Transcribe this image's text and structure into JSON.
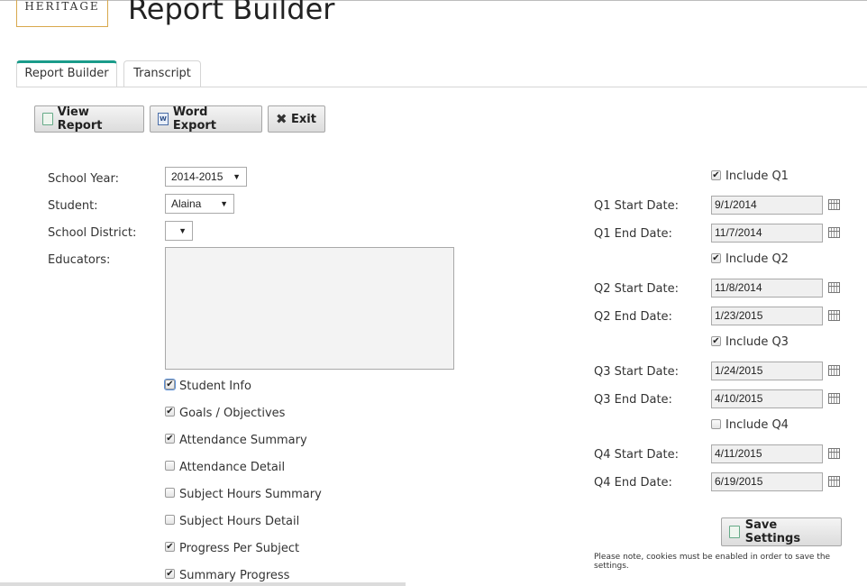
{
  "header": {
    "logo_text": "HERITAGE",
    "title": "Report Builder"
  },
  "tabs": [
    {
      "label": "Report Builder"
    },
    {
      "label": "Transcript"
    }
  ],
  "toolbar": {
    "view_report": "View Report",
    "word_export": "Word Export",
    "exit": "Exit"
  },
  "form": {
    "school_year_label": "School Year:",
    "school_year_value": "2014-2015",
    "student_label": "Student:",
    "student_value": "Alaina",
    "district_label": "School District:",
    "district_value": "",
    "educators_label": "Educators:"
  },
  "sections": [
    {
      "label": "Student Info",
      "checked": true
    },
    {
      "label": "Goals / Objectives",
      "checked": true
    },
    {
      "label": "Attendance Summary",
      "checked": true
    },
    {
      "label": "Attendance Detail",
      "checked": false
    },
    {
      "label": "Subject Hours Summary",
      "checked": false
    },
    {
      "label": "Subject Hours Detail",
      "checked": false
    },
    {
      "label": "Progress Per Subject",
      "checked": true
    },
    {
      "label": "Summary Progress",
      "checked": true
    }
  ],
  "quarters": [
    {
      "include_label": "Include Q1",
      "included": true,
      "start_label": "Q1 Start Date:",
      "start": "9/1/2014",
      "end_label": "Q1 End Date:",
      "end": "11/7/2014"
    },
    {
      "include_label": "Include Q2",
      "included": true,
      "start_label": "Q2 Start Date:",
      "start": "11/8/2014",
      "end_label": "Q2 End Date:",
      "end": "1/23/2015"
    },
    {
      "include_label": "Include Q3",
      "included": true,
      "start_label": "Q3 Start Date:",
      "start": "1/24/2015",
      "end_label": "Q3 End Date:",
      "end": "4/10/2015"
    },
    {
      "include_label": "Include Q4",
      "included": false,
      "start_label": "Q4 Start Date:",
      "start": "4/11/2015",
      "end_label": "Q4 End Date:",
      "end": "6/19/2015"
    }
  ],
  "save": {
    "label": "Save Settings",
    "note": "Please note, cookies must be enabled in order to save the settings."
  }
}
